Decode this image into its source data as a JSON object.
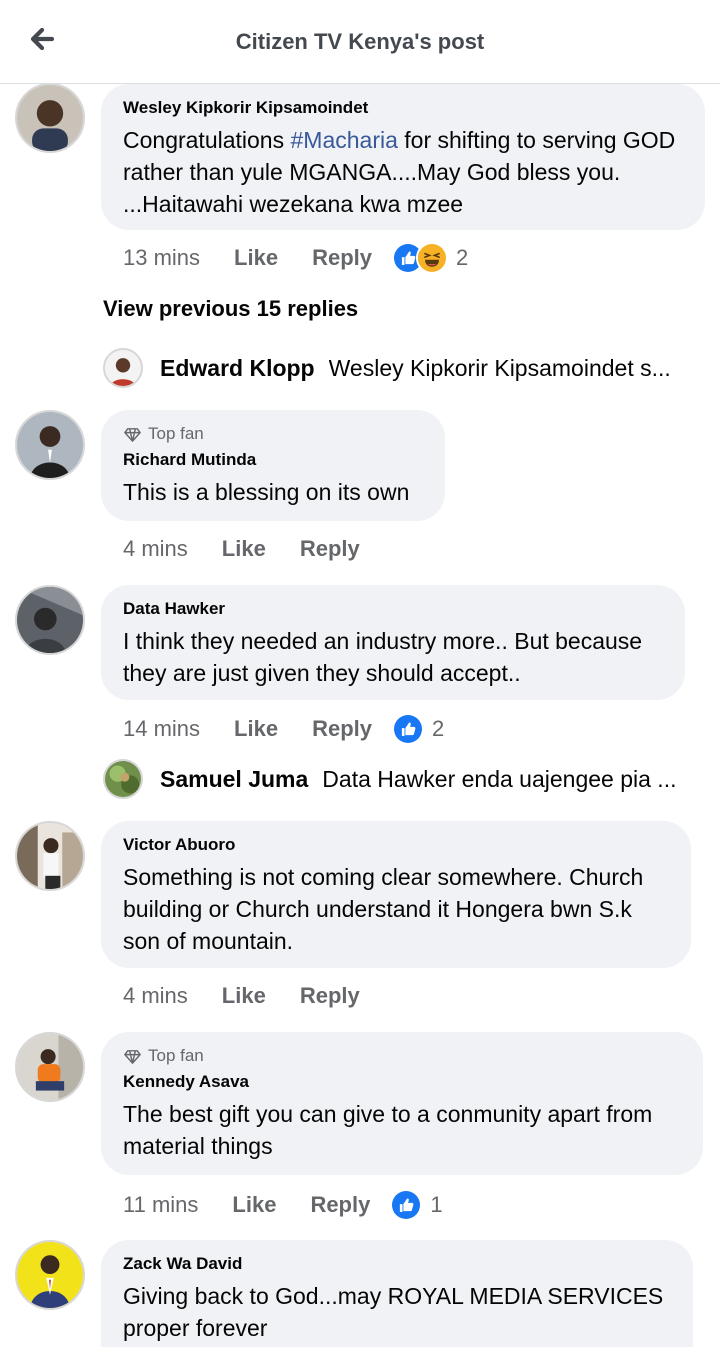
{
  "header": {
    "title": "Citizen TV Kenya's post"
  },
  "view_previous": "View previous 15 replies",
  "comments": [
    {
      "author": "Wesley Kipkorir Kipsamoindet",
      "text_pre": "Congratulations ",
      "hashtag": "#Macharia",
      "text_post": " for shifting to serving GOD rather than yule MGANGA....May God bless you. ...Haitawahi wezekana kwa mzee",
      "time": "13 mins",
      "like": "Like",
      "reply": "Reply",
      "reaction_count": "2"
    },
    {
      "top_fan": "Top fan",
      "author": "Richard Mutinda",
      "text": "This is a blessing on its own",
      "time": "4 mins",
      "like": "Like",
      "reply": "Reply"
    },
    {
      "author": "Data Hawker",
      "text": "I think they needed an industry more.. But because they are just given they should accept..",
      "time": "14 mins",
      "like": "Like",
      "reply": "Reply",
      "reaction_count": "2"
    },
    {
      "author": "Victor Abuoro",
      "text": "Something is not coming clear somewhere. Church building or Church understand it Hongera bwn S.k son of mountain.",
      "time": "4 mins",
      "like": "Like",
      "reply": "Reply"
    },
    {
      "top_fan": "Top fan",
      "author": "Kennedy Asava",
      "text": "The best gift you can give to a conmunity apart from material things",
      "time": "11 mins",
      "like": "Like",
      "reply": "Reply",
      "reaction_count": "1"
    },
    {
      "author": "Zack Wa David",
      "text": "Giving back to God...may ROYAL MEDIA SERVICES proper forever"
    }
  ],
  "replies": [
    {
      "name": "Edward Klopp",
      "text": "Wesley Kipkorir Kipsamoindet  s..."
    },
    {
      "name": "Samuel Juma",
      "text": "Data Hawker enda uajengee pia ..."
    }
  ],
  "colors": {
    "bubble": "#f0f2f5",
    "secondary_text": "#65676b",
    "hashtag": "#385898",
    "like_blue": "#1877f2",
    "haha_yellow": "#f7b125"
  },
  "icons": [
    "back-arrow-icon",
    "diamond-icon",
    "like-reaction-icon",
    "haha-reaction-icon"
  ]
}
